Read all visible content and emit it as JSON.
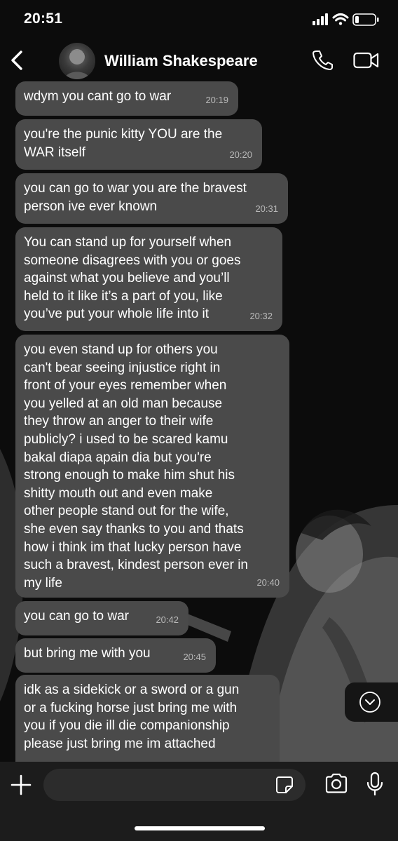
{
  "status": {
    "time": "20:51"
  },
  "header": {
    "contact_name": "William Shakespeare"
  },
  "messages": [
    {
      "text": "wdym you cant go to war",
      "time": "20:19"
    },
    {
      "text": "you're the punic kitty YOU are the\nWAR itself",
      "time": "20:20"
    },
    {
      "text": "you can go to war you are the bravest\nperson ive ever known",
      "time": "20:31"
    },
    {
      "text": "You can stand up for yourself when\nsomeone disagrees with you or goes\nagainst what you believe and you’ll\nheld to it like it’s a part of you, like\nyou’ve put your whole life into it",
      "time": "20:32"
    },
    {
      "text": "you even stand up for others you\ncan't bear seeing injustice right in\nfront of your eyes remember when\nyou yelled at an old man because\nthey throw an anger to their wife\npublicly? i used to be scared kamu\nbakal diapa apain dia but you're\nstrong enough to make him shut his\nshitty mouth out and even make\nother people stand out for the wife,\nshe even say thanks to you and thats\nhow i think im that lucky person have\nsuch a bravest, kindest person ever in\nmy life",
      "time": "20:40"
    },
    {
      "text": "you can go to war",
      "time": "20:42"
    },
    {
      "text": "but bring me with you",
      "time": "20:45"
    },
    {
      "text": "idk as a sidekick or a sword or a gun\nor a fucking horse just bring me with\nyou if you die ill die companionship\nplease just bring me im attached",
      "time": ""
    }
  ],
  "input": {
    "placeholder": "",
    "value": ""
  },
  "icons": {
    "back": "chevron-left-icon",
    "call": "phone-icon",
    "video": "video-camera-icon",
    "attach": "plus-icon",
    "sticker": "sticker-icon",
    "camera": "camera-icon",
    "mic": "microphone-icon",
    "scroll": "chevron-down-circle-icon"
  },
  "colors": {
    "bubble": "#4a4a4a",
    "background": "#0c0c0c",
    "input_bar": "#1c1c1c"
  }
}
